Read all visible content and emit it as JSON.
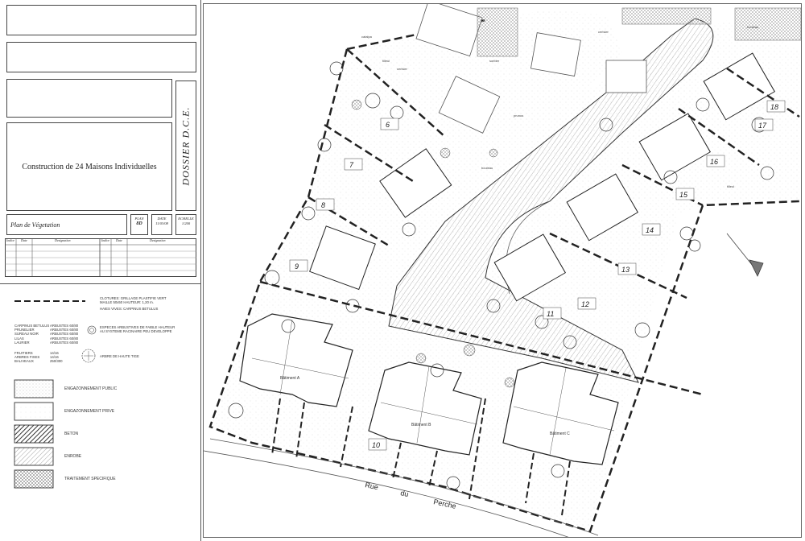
{
  "cartouche": {
    "project_title": "Construction de 24 Maisons Individuelles",
    "dossier": "DOSSIER D.C.E.",
    "plan_title": "Plan de Végetation",
    "plan_label": "PLAN",
    "plan_value": "8D",
    "date_label": "DATE",
    "date_value": "11/03/08",
    "scale_label": "ECHELLE",
    "scale_value": "1/200",
    "revision_headers": [
      "Indice",
      "Date",
      "Designation",
      "Indice",
      "Date",
      "Designation"
    ]
  },
  "legend": {
    "fence_text": [
      "CLOTURES: GRILLAGE PLASTIFIE VERT",
      "MAILLE 50x50   HAUTEUR: 1,20 m.",
      "HAIES VIVES: CARPINUS BETULUS"
    ],
    "shrubs_list": [
      "CARPINUS BETULUS",
      "PRUNELIER",
      "SUREAU NOIR",
      "LILAS",
      "LAURIER"
    ],
    "shrubs_sizes": [
      "ARBUSTES 60/80",
      "ARBUSTES 60/80",
      "ARBUSTES 60/80",
      "ARBUSTES 60/80",
      "ARBUSTES 60/80"
    ],
    "shrubs_desc": [
      "ESPECES ARBUSTIVES DE FAIBLE HAUTEUR",
      "AU SYSTEME RACINAIRE PEU DEVELOPPE"
    ],
    "trees_list": [
      "FRUITIERS",
      "ARBRES FIXES",
      "BALIVEAUX"
    ],
    "trees_sizes": [
      "14/16",
      "14/16",
      "250/300"
    ],
    "trees_desc": "ARBRE DE HAUTE TIGE",
    "surfaces": [
      {
        "label": "ENGAZONNEMENT PUBLIC",
        "pattern": "dots-dense"
      },
      {
        "label": "ENGAZONNEMENT PRIVE",
        "pattern": "dots-light"
      },
      {
        "label": "BETON",
        "pattern": "hatch-dark"
      },
      {
        "label": "ENROBE",
        "pattern": "hatch-light"
      },
      {
        "label": "TRAITEMENT SPECIFIQUE",
        "pattern": "crosshatch"
      }
    ]
  },
  "plan": {
    "lots": [
      "6",
      "7",
      "8",
      "9",
      "10",
      "11",
      "12",
      "13",
      "14",
      "15",
      "16",
      "17",
      "18"
    ],
    "buildings": [
      "Bâtiment A",
      "Bâtiment B",
      "Bâtiment C"
    ],
    "street": [
      "Rue",
      "du",
      "Perche"
    ],
    "trees": [
      "tilleul",
      "cerisier",
      "sorbier",
      "catalpa",
      "prunus",
      "bouleau",
      "cerisier",
      "bouleau",
      "tilleul"
    ]
  }
}
